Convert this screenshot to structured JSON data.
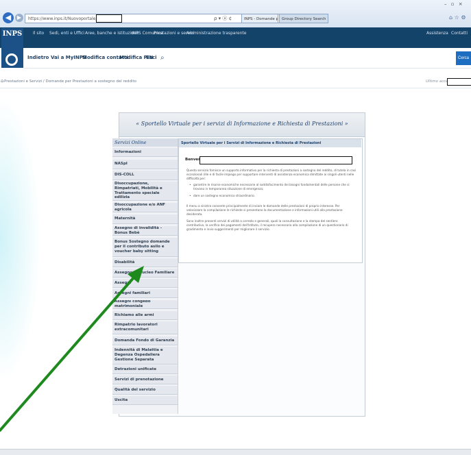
{
  "browser": {
    "url": "https://www.inps.it/Nuovoportale/inps.",
    "address_icons": "ρ ▾ ⓐ ¢",
    "tabs": [
      "INPS - Domande per Presta...",
      "Group Directory Search"
    ],
    "window_controls": "– ▫ ×",
    "tool_icons": "⌂ ☆ ⚙"
  },
  "header": {
    "logo_text": "INPS",
    "top_links": [
      "Il sito",
      "Sedi, enti e Uffici",
      "Aree, banche e istituzione",
      "INPS Comunica",
      "Prestazioni e servizi",
      "Amministrazione trasparente"
    ],
    "right_links": [
      "Assistenza",
      "Contatti"
    ],
    "sub_links": [
      "Indietro",
      "Vai a MyINPS",
      "Modifica contatti",
      "Modifica PIN",
      "Esci"
    ],
    "search_icon": "search-icon",
    "search_button": "Cerca"
  },
  "breadcrumb": {
    "text": "Prestazioni e Servizi  /  Domande per Prestazioni a sostegno del reddito",
    "last_access": "Ultimo accesso"
  },
  "panel": {
    "title": "« Sportello Virtuale per i servizi di Informazione e Richiesta di Prestazioni »"
  },
  "sidebar": {
    "header": "Servizi Online",
    "items": [
      "Informazioni",
      "NASpI",
      "DIS-COLL",
      "Disoccupazione, Rimpatriati, Mobilità e Trattamento speciale edilizia",
      "Disoccupazione e/o ANF agricola",
      "Maternità",
      "Assegno di invalidità - Bonus Bebè",
      "Bonus Sostegno domande per il contributo asilo e voucher baby sitting",
      "Disabilità",
      "Assegno al Nucleo Familiare",
      "Assegni",
      "Assegni familiari",
      "Assegni congedo matrimoniale",
      "Richiamo alle armi",
      "Rimpatrio lavoratori extracomunitari",
      "Domanda Fondo di Garanzia",
      "Indennità di Malattia e Degenza Ospedaliera Gestione Separata",
      "Detrazioni unificate",
      "Servizi di prenotazione",
      "Qualità del servizio",
      "Uscita"
    ]
  },
  "content": {
    "header": "Sportello Virtuale per i Servizi di Informazione e Richiesta di Prestazioni",
    "welcome_label": "Benvenuto",
    "paragraph_1": "Questo servizio fornisce un supporto informativo per la richiesta di prestazioni a sostegno del reddito, di tutela in casi eccezionali (ille e di facile impiego per supportare interventi di assistenza economica dimittate ai singoli utenti nelle difficoltà per:",
    "bullets": [
      "garantire le risorse economiche necessarie al soddisfacimento dei bisogni fondamentali delle persone che si trovano in temporanea situazione di emergenza;",
      "dare un sostegno economico straordinario."
    ],
    "paragraph_2": "Il menu a sinistra consente principalmente di inviare le domande delle prestazioni di proprio interesse. Per velocizzare la compilazione le richieste si presentano la documentazione e informazioni utili alla prestazione desiderata.",
    "paragraph_3": "Sono inoltre presenti servizi di utilità a corredo e generali, quali la consultazione e la stampa del sentiero contributivo, la verifica dei pagamenti dell'Istituto, il recupero necessario alla compilazione di un questionario di gradimento e invio suggerimenti per migliorare il servizio."
  },
  "colors": {
    "header_blue": "#14436a",
    "accent_blue": "#1d6ec0",
    "arrow_green": "#1e8a1e"
  }
}
